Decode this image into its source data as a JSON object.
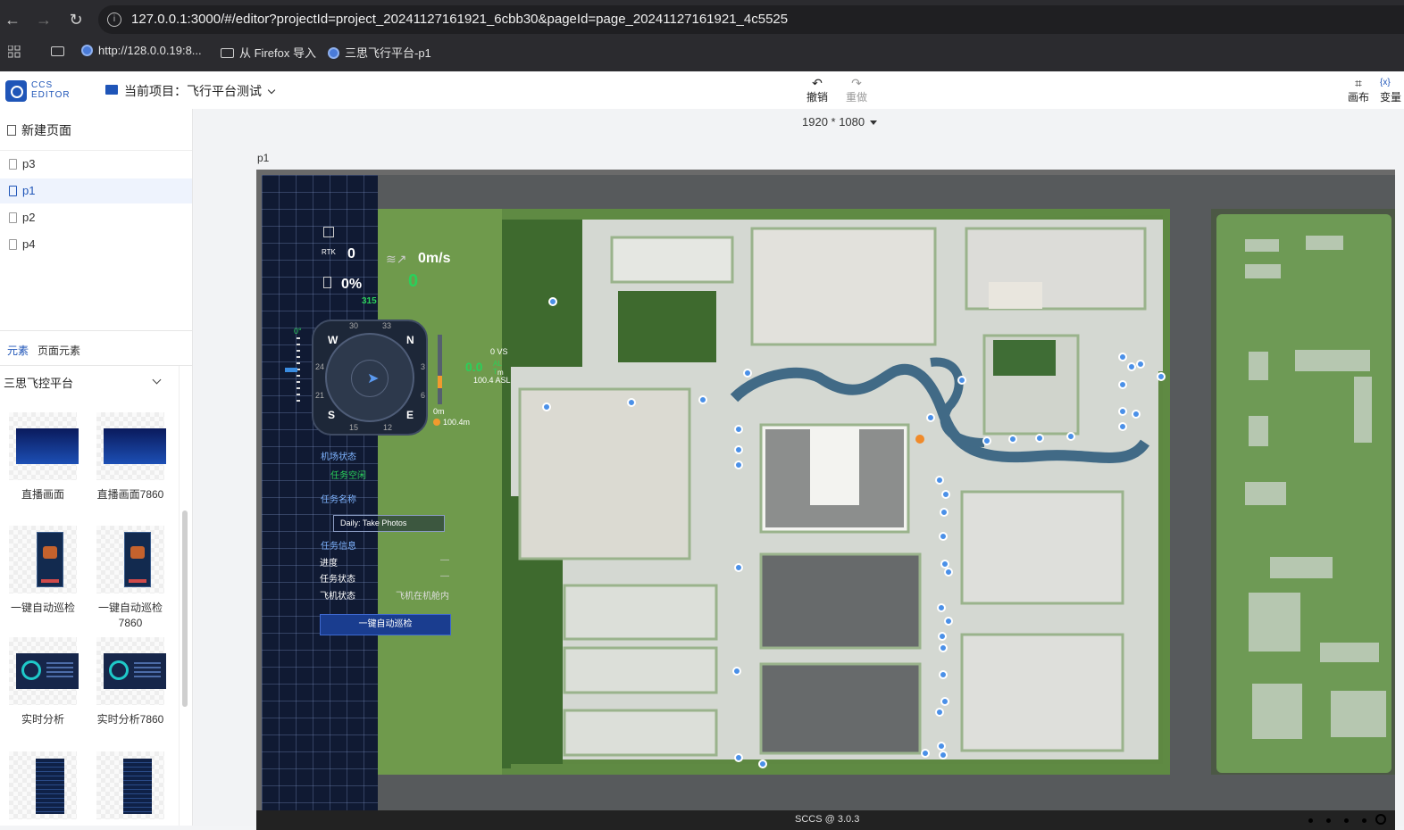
{
  "browser": {
    "url": "127.0.0.1:3000/#/editor?projectId=project_20241127161921_6cbb30&pageId=page_20241127161921_4c5525",
    "bookmarks": [
      {
        "label": "http://128.0.0.19:8..."
      },
      {
        "label": "从 Firefox 导入"
      },
      {
        "label": "三思飞行平台-p1"
      }
    ]
  },
  "header": {
    "logo_line1": "CCS",
    "logo_line2": "EDITOR",
    "project_label": "当前项目：飞行平台测试",
    "undo_label": "撤销",
    "redo_label": "重做",
    "canvas_label": "画布",
    "variable_label": "变量"
  },
  "sidebar": {
    "new_page_label": "新建页面",
    "pages": [
      {
        "label": "p3",
        "active": false
      },
      {
        "label": "p1",
        "active": true
      },
      {
        "label": "p2",
        "active": false
      },
      {
        "label": "p4",
        "active": false
      }
    ],
    "tab_elements": "元素",
    "tab_page_elements": "页面元素",
    "group_title": "三思飞控平台",
    "components": [
      {
        "label": "直播画面",
        "thumb": "city-blue"
      },
      {
        "label": "直播画面7860",
        "thumb": "city-blue"
      },
      {
        "label": "一键自动巡检",
        "thumb": "panel-orange"
      },
      {
        "label": "一键自动巡检7860",
        "thumb": "panel-orange"
      },
      {
        "label": "实时分析",
        "thumb": "analysis-cyan"
      },
      {
        "label": "实时分析7860",
        "thumb": "analysis-cyan"
      },
      {
        "label": "",
        "thumb": "table-dark"
      },
      {
        "label": "",
        "thumb": "table-dark"
      }
    ]
  },
  "canvas": {
    "resolution": "1920 * 1080",
    "page_name": "p1",
    "footer": "SCCS @ 3.0.3"
  },
  "hud": {
    "rtk_value": "0",
    "battery": "0%",
    "wind_speed": "0m/s",
    "speed_value": "0",
    "heading_top": "315",
    "pitch": "0°",
    "compass": {
      "n": "N",
      "s": "S",
      "e": "E",
      "w": "W",
      "t30": "30",
      "t33": "33",
      "t3": "3",
      "t6": "6",
      "t12": "12",
      "t15": "15",
      "t21": "21",
      "t24": "24"
    },
    "vs_label": "0 VS",
    "alt_value": "0.0",
    "alt_unit": "m",
    "asl": "100.4 ASL",
    "ground": "0m",
    "home_alt": "100.4m",
    "dock_status_title": "机场状态",
    "dock_status_value": "任务空闲",
    "task_name_title": "任务名称",
    "task_name_value": "Daily: Take Photos",
    "task_info_title": "任务信息",
    "progress_label": "进度",
    "progress_value": "—",
    "task_status_label": "任务状态",
    "task_status_value": "—",
    "aircraft_status_label": "飞机状态",
    "aircraft_status_value": "飞机在机舱内",
    "patrol_button": "一键自动巡检"
  },
  "colors": {
    "accent": "#1f55b8",
    "hud_green": "#2ad05a",
    "grid_bg": "#101a33"
  }
}
